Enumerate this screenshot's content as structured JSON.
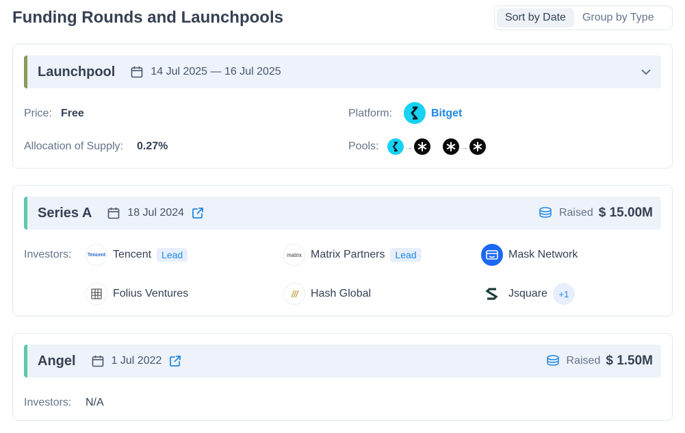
{
  "page": {
    "title": "Funding Rounds and Launchpools"
  },
  "sort_toggle": {
    "options": [
      "Sort by Date",
      "Group by Type"
    ],
    "active": "Sort by Date"
  },
  "colors": {
    "launchpool_accent": "#8a9a5b",
    "round_accent": "#5ec9a8",
    "link": "#1e88e5",
    "platform_brand": "#17d2f2"
  },
  "launchpool": {
    "title": "Launchpool",
    "date_range": "14 Jul 2025 — 16 Jul 2025",
    "price_label": "Price:",
    "price_value": "Free",
    "allocation_label": "Allocation of Supply:",
    "allocation_value": "0.27%",
    "platform_label": "Platform:",
    "platform_name": "Bitget",
    "pools_label": "Pools:",
    "pools": [
      {
        "from_icon": "bitget-coin-icon",
        "to_icon": "project-token-icon"
      },
      {
        "from_icon": "project-token-icon",
        "to_icon": "project-token-icon"
      }
    ]
  },
  "rounds": [
    {
      "title": "Series A",
      "date": "18 Jul 2024",
      "raised_label": "Raised",
      "raised_value": "$ 15.00M",
      "investors_label": "Investors:",
      "investors": [
        {
          "name": "Tencent",
          "lead": "Lead",
          "logo_text": "Tencent"
        },
        {
          "name": "Matrix Partners",
          "lead": "Lead",
          "logo_text": "matrix"
        },
        {
          "name": "Mask Network",
          "lead": "",
          "logo_text": ""
        },
        {
          "name": "Folius Ventures",
          "lead": "",
          "logo_text": ""
        },
        {
          "name": "Hash Global",
          "lead": "",
          "logo_text": ""
        },
        {
          "name": "Jsquare",
          "lead": "",
          "logo_text": ""
        }
      ],
      "more_count": "+1"
    },
    {
      "title": "Angel",
      "date": "1 Jul 2022",
      "raised_label": "Raised",
      "raised_value": "$ 1.50M",
      "investors_label": "Investors:",
      "investors_value": "N/A"
    }
  ]
}
